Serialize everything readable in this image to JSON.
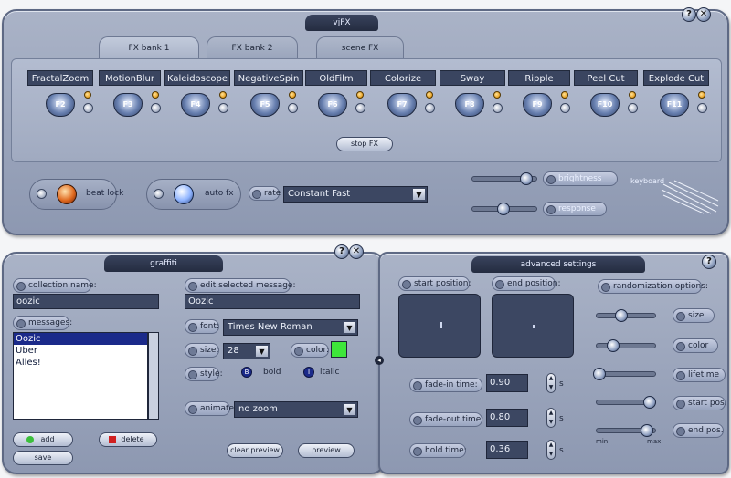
{
  "vjfx": {
    "title": "vjFX",
    "help": "?",
    "close": "✕",
    "tabs": [
      "FX bank 1",
      "FX bank 2",
      "scene FX"
    ],
    "effects": [
      {
        "name": "FractalZoom",
        "key": "F2"
      },
      {
        "name": "MotionBlur",
        "key": "F3"
      },
      {
        "name": "Kaleidoscope",
        "key": "F4"
      },
      {
        "name": "NegativeSpin",
        "key": "F5"
      },
      {
        "name": "OldFilm",
        "key": "F6"
      },
      {
        "name": "Colorize",
        "key": "F7"
      },
      {
        "name": "Sway",
        "key": "F8"
      },
      {
        "name": "Ripple",
        "key": "F9"
      },
      {
        "name": "Peel Cut",
        "key": "F10"
      },
      {
        "name": "Explode Cut",
        "key": "F11"
      }
    ],
    "stop_fx": "stop FX",
    "beat_lock": "beat lock",
    "auto_fx": "auto fx",
    "rate_label": "rate",
    "rate_value": "Constant Fast",
    "brightness_label": "brightness",
    "response_label": "response",
    "brightness_level": 0.82,
    "response_level": 0.45,
    "keyboard_label": "keyboard"
  },
  "graffiti": {
    "title": "graffiti",
    "help": "?",
    "close": "✕",
    "collection_name_label": "collection name:",
    "collection_name_value": "oozic",
    "messages_label": "messages:",
    "messages": [
      "Oozic",
      "Uber",
      "Alles!"
    ],
    "selected_message_index": 0,
    "edit_label": "edit selected message:",
    "edit_value": "Oozic",
    "font_label": "font:",
    "font_value": "Times New Roman",
    "size_label": "size:",
    "size_value": "28",
    "color_label": "color:",
    "color_value": "#3ee63a",
    "style_label": "style:",
    "bold_label": "bold",
    "italic_label": "italic",
    "animate_label": "animate:",
    "animate_value": "no zoom",
    "add_button": "add",
    "delete_button": "delete",
    "save_button": "save",
    "clear_preview_button": "clear preview",
    "preview_button": "preview"
  },
  "advanced": {
    "title": "advanced settings",
    "help": "?",
    "start_position_label": "start position:",
    "end_position_label": "end position:",
    "fade_in_label": "fade-in time:",
    "fade_in_value": "0.90",
    "fade_out_label": "fade-out time:",
    "fade_out_value": "0.80",
    "hold_label": "hold time:",
    "hold_value": "0.36",
    "seconds_unit": "s",
    "randomization_label": "randomization options:",
    "options": [
      {
        "label": "size",
        "level": 0.4
      },
      {
        "label": "color",
        "level": 0.25
      },
      {
        "label": "lifetime",
        "level": 0.02
      },
      {
        "label": "start pos.",
        "level": 0.9
      },
      {
        "label": "end pos.",
        "level": 0.85
      }
    ],
    "min_label": "min",
    "max_label": "max"
  }
}
